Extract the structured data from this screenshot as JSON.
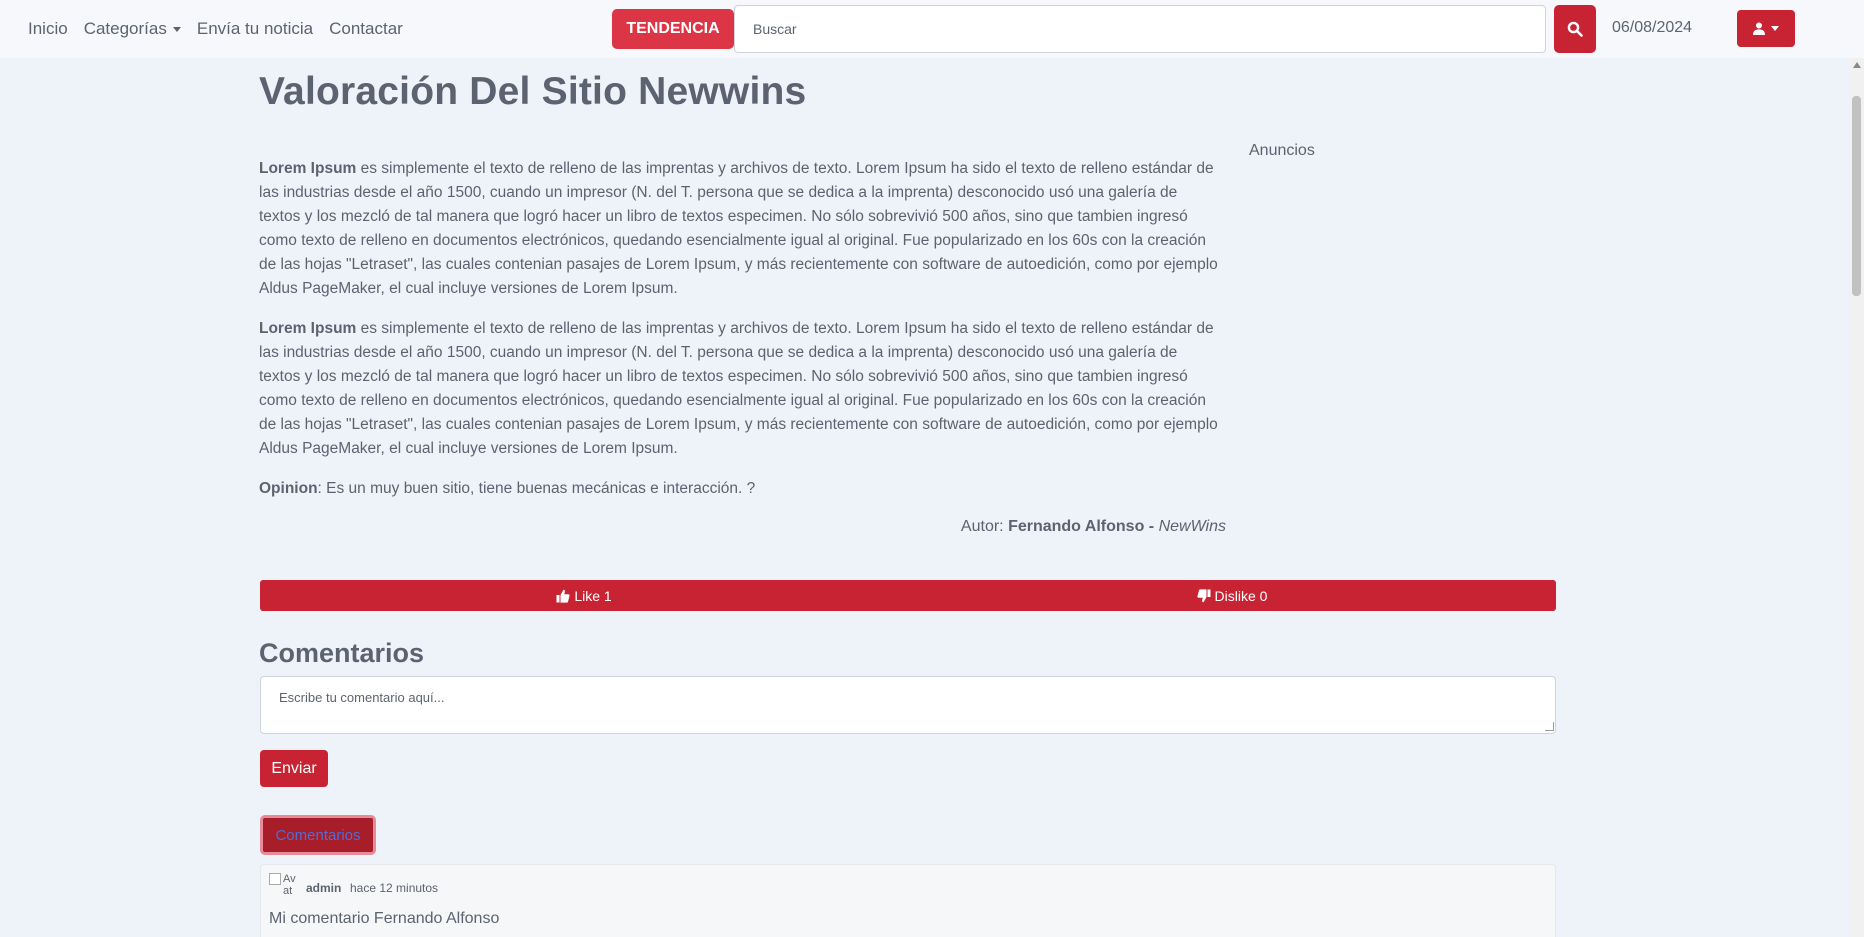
{
  "nav": {
    "items": [
      "Inicio",
      "Categorías",
      "Envía tu noticia",
      "Contactar"
    ],
    "trend_label": "TENDENCIA",
    "search_placeholder": "Buscar",
    "date": "06/08/2024"
  },
  "article": {
    "title": "Valoración Del Sitio Newwins",
    "paragraphs": [
      {
        "bold": "Lorem Ipsum",
        "text": " es simplemente el texto de relleno de las imprentas y archivos de texto. Lorem Ipsum ha sido el texto de relleno estándar de las industrias desde el año 1500, cuando un impresor (N. del T. persona que se dedica a la imprenta) desconocido usó una galería de textos y los mezcló de tal manera que logró hacer un libro de textos especimen. No sólo sobrevivió 500 años, sino que tambien ingresó como texto de relleno en documentos electrónicos, quedando esencialmente igual al original. Fue popularizado en los 60s con la creación de las hojas \"Letraset\", las cuales contenian pasajes de Lorem Ipsum, y más recientemente con software de autoedición, como por ejemplo Aldus PageMaker, el cual incluye versiones de Lorem Ipsum."
      },
      {
        "bold": "Lorem Ipsum",
        "text": " es simplemente el texto de relleno de las imprentas y archivos de texto. Lorem Ipsum ha sido el texto de relleno estándar de las industrias desde el año 1500, cuando un impresor (N. del T. persona que se dedica a la imprenta) desconocido usó una galería de textos y los mezcló de tal manera que logró hacer un libro de textos especimen. No sólo sobrevivió 500 años, sino que tambien ingresó como texto de relleno en documentos electrónicos, quedando esencialmente igual al original. Fue popularizado en los 60s con la creación de las hojas \"Letraset\", las cuales contenian pasajes de Lorem Ipsum, y más recientemente con software de autoedición, como por ejemplo Aldus PageMaker, el cual incluye versiones de Lorem Ipsum."
      }
    ],
    "opinion_label": "Opinion",
    "opinion_text": ": Es un muy buen sitio, tiene buenas mecánicas e interacción.  ?",
    "author_prefix": "Autor: ",
    "author_name": "Fernando Alfonso",
    "author_sep": " - ",
    "author_site": "NewWins"
  },
  "sidebar": {
    "ads_label": "Anuncios"
  },
  "votes": {
    "like_label": "Like 1",
    "dislike_label": "Dislike 0"
  },
  "comments": {
    "heading": "Comentarios",
    "placeholder": "Escribe tu comentario aquí...",
    "send_label": "Enviar",
    "toggle_label": "Comentarios",
    "items": [
      {
        "user": "admin",
        "time": "hace 12 minutos",
        "text": "Mi comentario Fernando Alfonso",
        "avatar_alt": "Av at"
      }
    ]
  },
  "colors": {
    "accent": "#c82333",
    "trend": "#dc3545",
    "background": "#eef2f9",
    "text": "#5c6370"
  }
}
